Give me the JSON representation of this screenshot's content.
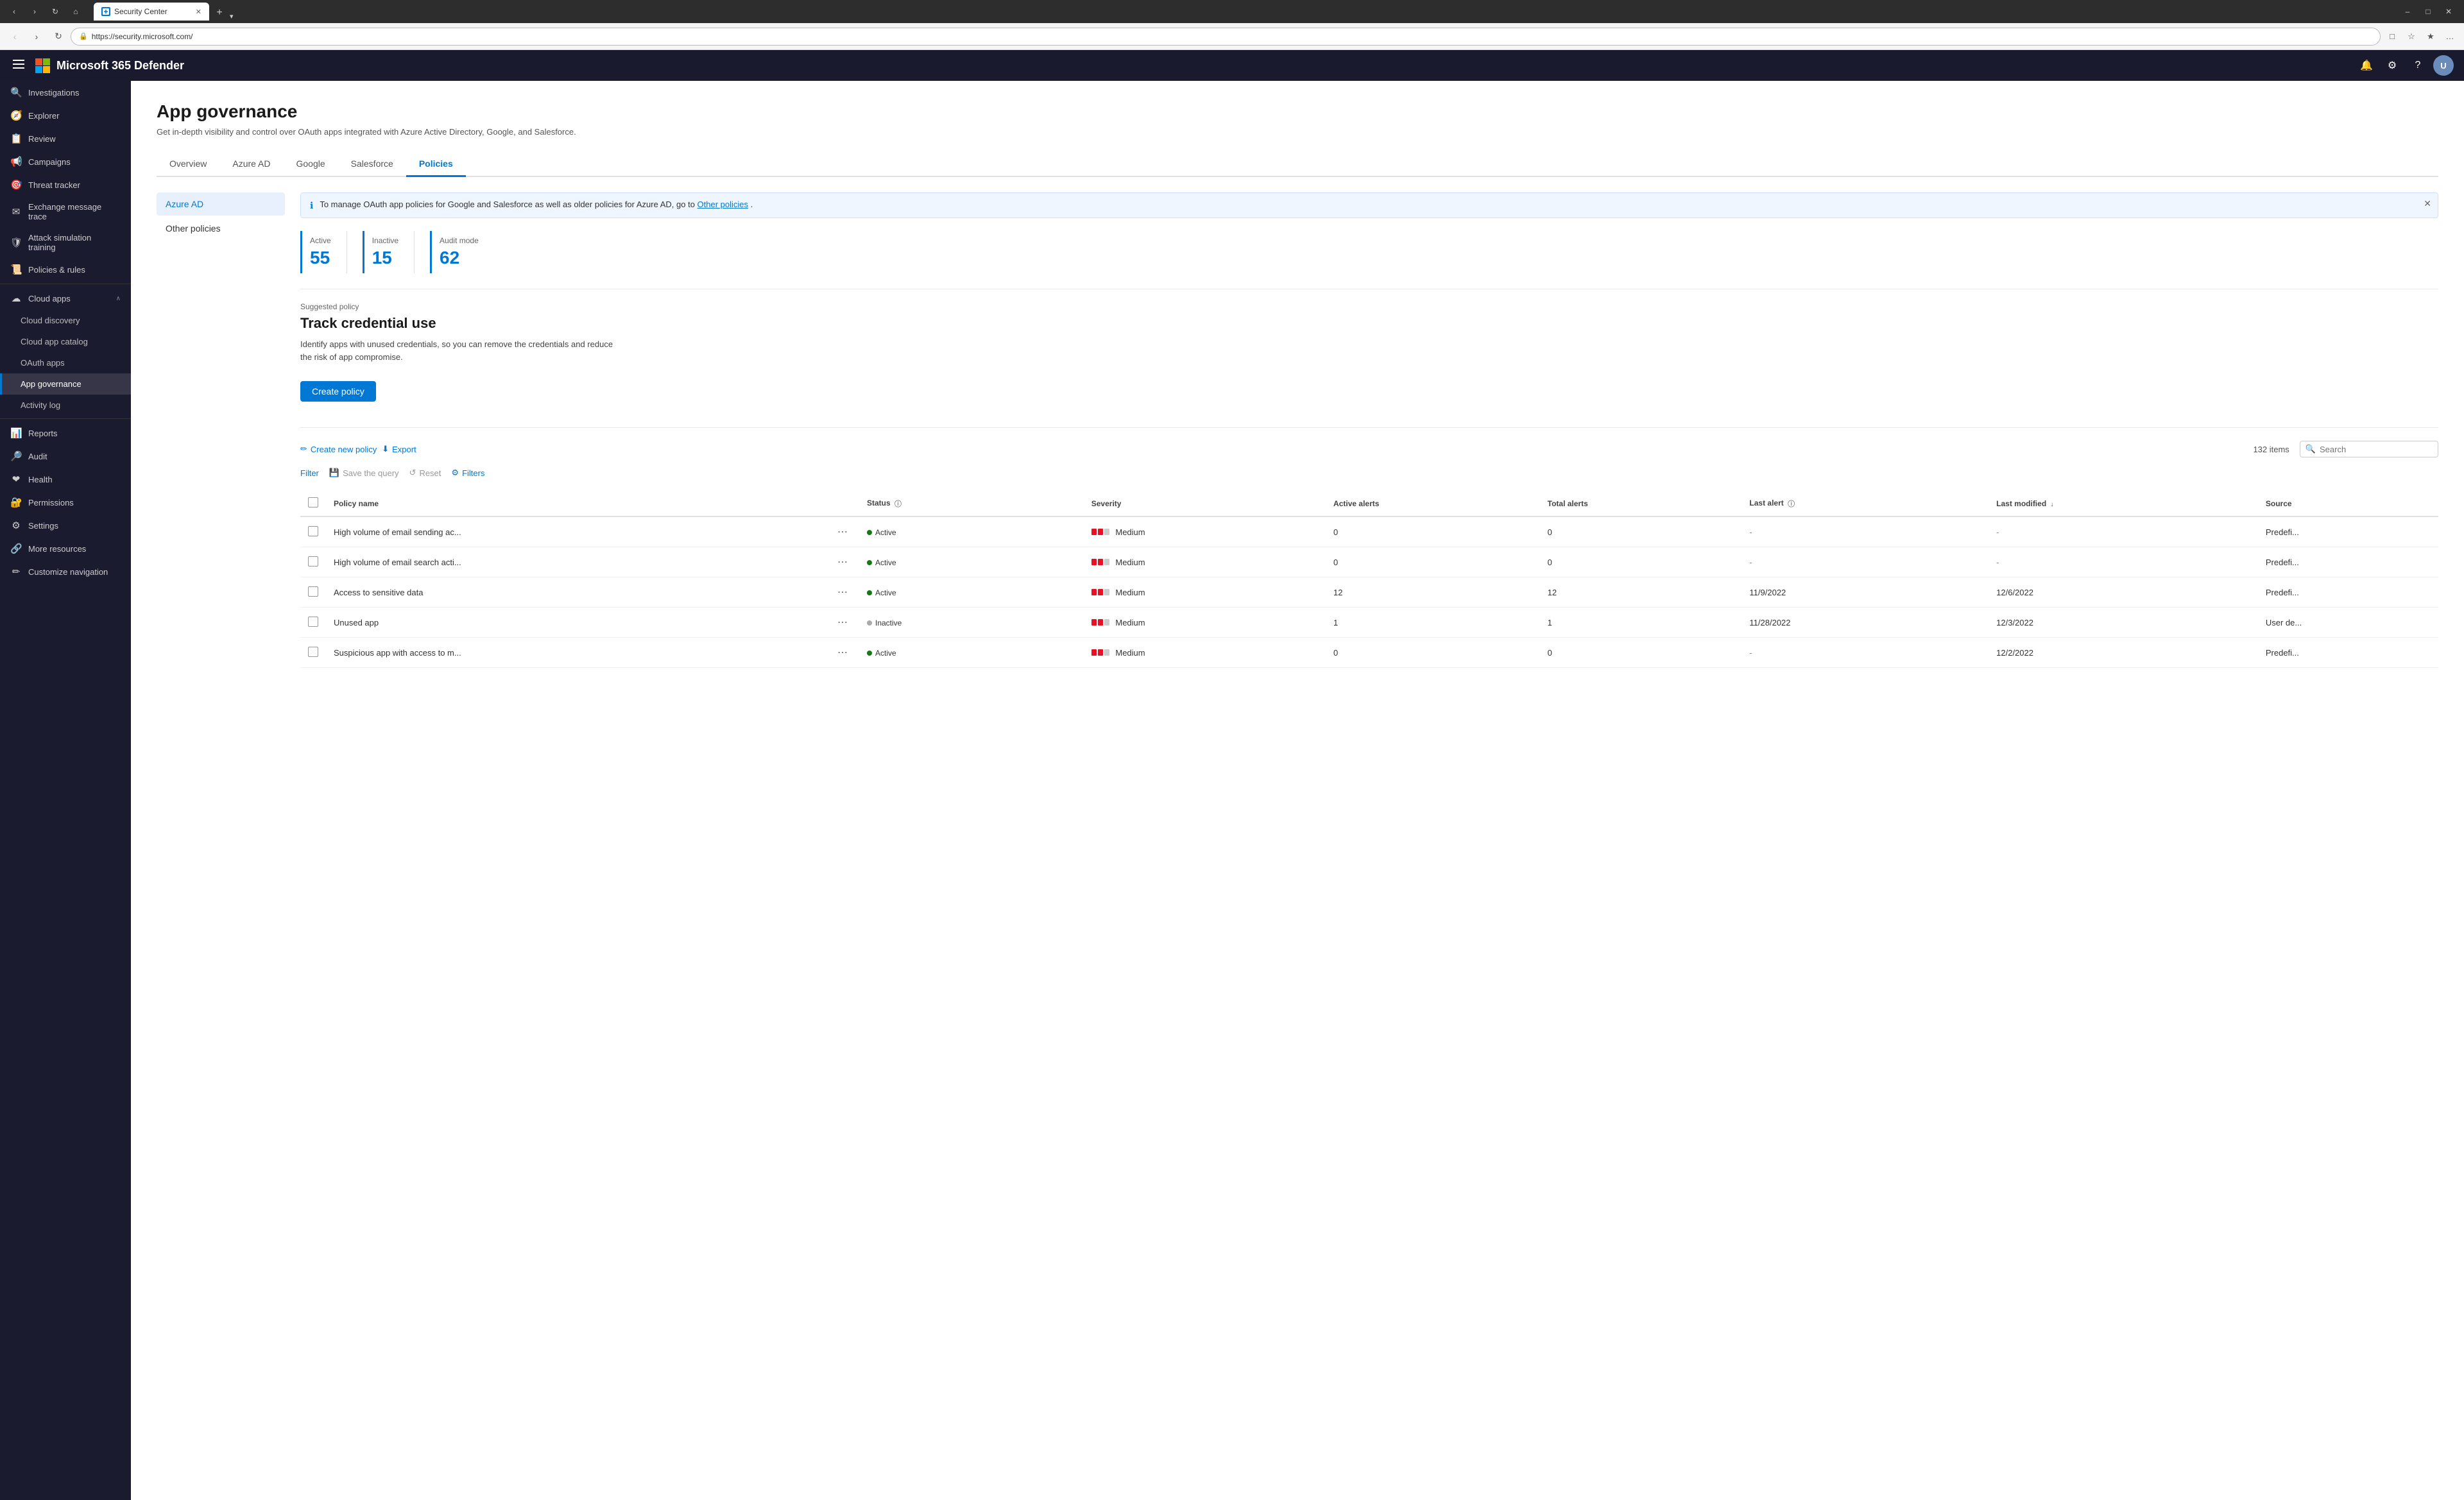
{
  "browser": {
    "tab_title": "Security Center",
    "tab_favicon": "S",
    "url": "https://security.microsoft.com/",
    "new_tab_label": "+",
    "window_controls": {
      "minimize": "–",
      "maximize": "□",
      "close": "✕"
    }
  },
  "topbar": {
    "app_name": "Microsoft 365 Defender",
    "menu_icon": "☰",
    "bell_icon": "🔔",
    "gear_icon": "⚙",
    "help_icon": "?",
    "avatar_initials": "U"
  },
  "sidebar": {
    "collapse_icon": "☰",
    "items": [
      {
        "id": "investigations",
        "label": "Investigations",
        "icon": "🔍"
      },
      {
        "id": "explorer",
        "label": "Explorer",
        "icon": "🧭"
      },
      {
        "id": "review",
        "label": "Review",
        "icon": "📋"
      },
      {
        "id": "campaigns",
        "label": "Campaigns",
        "icon": "📢"
      },
      {
        "id": "threat-tracker",
        "label": "Threat tracker",
        "icon": "🎯"
      },
      {
        "id": "exchange",
        "label": "Exchange message trace",
        "icon": "✉"
      },
      {
        "id": "attack-sim",
        "label": "Attack simulation training",
        "icon": "🛡"
      },
      {
        "id": "policies-rules",
        "label": "Policies & rules",
        "icon": "📜"
      }
    ],
    "cloud_apps_section": {
      "label": "Cloud apps",
      "icon": "☁",
      "chevron": "∧",
      "children": [
        {
          "id": "cloud-discovery",
          "label": "Cloud discovery",
          "icon": "🔭"
        },
        {
          "id": "cloud-app-catalog",
          "label": "Cloud app catalog",
          "icon": "📚"
        },
        {
          "id": "oauth-apps",
          "label": "OAuth apps",
          "icon": "🔑"
        },
        {
          "id": "app-governance",
          "label": "App governance",
          "icon": "🏛",
          "active": true
        },
        {
          "id": "activity-log",
          "label": "Activity log",
          "icon": "📄"
        }
      ]
    },
    "bottom_items": [
      {
        "id": "reports",
        "label": "Reports",
        "icon": "📊"
      },
      {
        "id": "audit",
        "label": "Audit",
        "icon": "🔎"
      },
      {
        "id": "health",
        "label": "Health",
        "icon": "❤"
      },
      {
        "id": "permissions",
        "label": "Permissions",
        "icon": "🔐"
      },
      {
        "id": "settings",
        "label": "Settings",
        "icon": "⚙"
      },
      {
        "id": "more-resources",
        "label": "More resources",
        "icon": "🔗"
      },
      {
        "id": "customize-nav",
        "label": "Customize navigation",
        "icon": "✏"
      }
    ]
  },
  "page": {
    "title": "App governance",
    "subtitle": "Get in-depth visibility and control over OAuth apps integrated with Azure Active Directory, Google, and Salesforce.",
    "tabs": [
      {
        "id": "overview",
        "label": "Overview",
        "active": false
      },
      {
        "id": "azure-ad",
        "label": "Azure AD",
        "active": false
      },
      {
        "id": "google",
        "label": "Google",
        "active": false
      },
      {
        "id": "salesforce",
        "label": "Salesforce",
        "active": false
      },
      {
        "id": "policies",
        "label": "Policies",
        "active": true
      }
    ],
    "left_nav": [
      {
        "id": "azure-ad",
        "label": "Azure AD",
        "active": true
      },
      {
        "id": "other-policies",
        "label": "Other policies",
        "active": false
      }
    ],
    "info_banner": {
      "text": "To manage OAuth app policies for Google and Salesforce as well as older policies for Azure AD, go to ",
      "link_text": "Other policies",
      "link_suffix": "."
    },
    "stats": [
      {
        "id": "active",
        "label": "Active",
        "value": "55"
      },
      {
        "id": "inactive",
        "label": "Inactive",
        "value": "15"
      },
      {
        "id": "audit-mode",
        "label": "Audit mode",
        "value": "62"
      }
    ],
    "suggested_policy": {
      "label": "Suggested policy",
      "title": "Track credential use",
      "description": "Identify apps with unused credentials, so you can remove the credentials and reduce the risk of app compromise."
    },
    "create_policy_btn": "Create policy",
    "toolbar": {
      "create_new_policy": "Create new policy",
      "export": "Export",
      "items_count": "132 items",
      "search_placeholder": "Search"
    },
    "filter_bar": {
      "filter_label": "Filter",
      "save_query_label": "Save the query",
      "reset_label": "Reset",
      "filters_label": "Filters"
    },
    "table": {
      "columns": [
        {
          "id": "checkbox",
          "label": ""
        },
        {
          "id": "policy-name",
          "label": "Policy name"
        },
        {
          "id": "ellipsis",
          "label": ""
        },
        {
          "id": "status",
          "label": "Status",
          "has_info": true
        },
        {
          "id": "severity",
          "label": "Severity"
        },
        {
          "id": "active-alerts",
          "label": "Active alerts"
        },
        {
          "id": "total-alerts",
          "label": "Total alerts"
        },
        {
          "id": "last-alert",
          "label": "Last alert",
          "has_info": true
        },
        {
          "id": "last-modified",
          "label": "Last modified",
          "sorted": true
        },
        {
          "id": "source",
          "label": "Source"
        }
      ],
      "rows": [
        {
          "policy_name": "High volume of email sending ac...",
          "status": "Active",
          "status_type": "active",
          "severity": "Medium",
          "severity_bars": 2,
          "active_alerts": "0",
          "total_alerts": "0",
          "last_alert": "-",
          "last_modified": "-",
          "source": "Predefi..."
        },
        {
          "policy_name": "High volume of email search acti...",
          "status": "Active",
          "status_type": "active",
          "severity": "Medium",
          "severity_bars": 2,
          "active_alerts": "0",
          "total_alerts": "0",
          "last_alert": "-",
          "last_modified": "-",
          "source": "Predefi..."
        },
        {
          "policy_name": "Access to sensitive data",
          "status": "Active",
          "status_type": "active",
          "severity": "Medium",
          "severity_bars": 2,
          "active_alerts": "12",
          "total_alerts": "12",
          "last_alert": "11/9/2022",
          "last_modified": "12/6/2022",
          "source": "Predefi..."
        },
        {
          "policy_name": "Unused app",
          "status": "Inactive",
          "status_type": "inactive",
          "severity": "Medium",
          "severity_bars": 2,
          "active_alerts": "1",
          "total_alerts": "1",
          "last_alert": "11/28/2022",
          "last_modified": "12/3/2022",
          "source": "User de..."
        },
        {
          "policy_name": "Suspicious app with access to m...",
          "status": "Active",
          "status_type": "active",
          "severity": "Medium",
          "severity_bars": 2,
          "active_alerts": "0",
          "total_alerts": "0",
          "last_alert": "-",
          "last_modified": "12/2/2022",
          "source": "Predefi..."
        }
      ]
    }
  }
}
